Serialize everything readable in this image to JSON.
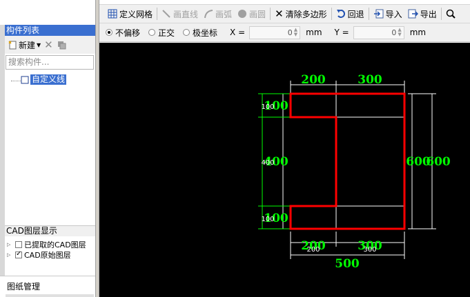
{
  "left_panel": {
    "component_list_title": "构件列表",
    "new_button_label": "新建",
    "search_placeholder": "搜索构件...",
    "tree_item_label": "自定义线",
    "cad_layer_title": "CAD图层显示",
    "cad_layers": [
      {
        "label": "已提取的CAD图层",
        "checked": false
      },
      {
        "label": "CAD原始图层",
        "checked": true
      }
    ],
    "drawing_tab_label": "图纸管理"
  },
  "toolbar": {
    "define_grid": "定义网格",
    "draw_line": "画直线",
    "draw_arc": "画弧",
    "draw_circle": "画圆",
    "clear_polygon": "清除多边形",
    "undo": "回退",
    "import": "导入",
    "export": "导出"
  },
  "options": {
    "no_offset": "不偏移",
    "orthogonal": "正交",
    "polar": "极坐标",
    "selected_mode": "不偏移",
    "x_label": "X =",
    "x_value": "0",
    "y_label": "Y =",
    "y_value": "0",
    "unit": "mm"
  },
  "canvas": {
    "background_color": "#000000",
    "outline_color": "#ff0000",
    "dimension_color": "#00ff00",
    "dims": {
      "top_left": "200",
      "top_right": "300",
      "bottom_left": "200",
      "bottom_right": "300",
      "bottom_left_small": "200",
      "bottom_right_small": "300",
      "bottom_total": "500",
      "left_top": "100",
      "left_top_small": "100",
      "left_mid": "400",
      "left_mid_small": "400",
      "left_bottom": "100",
      "left_bottom_small": "100",
      "right_inner": "600",
      "right_outer": "600"
    }
  }
}
